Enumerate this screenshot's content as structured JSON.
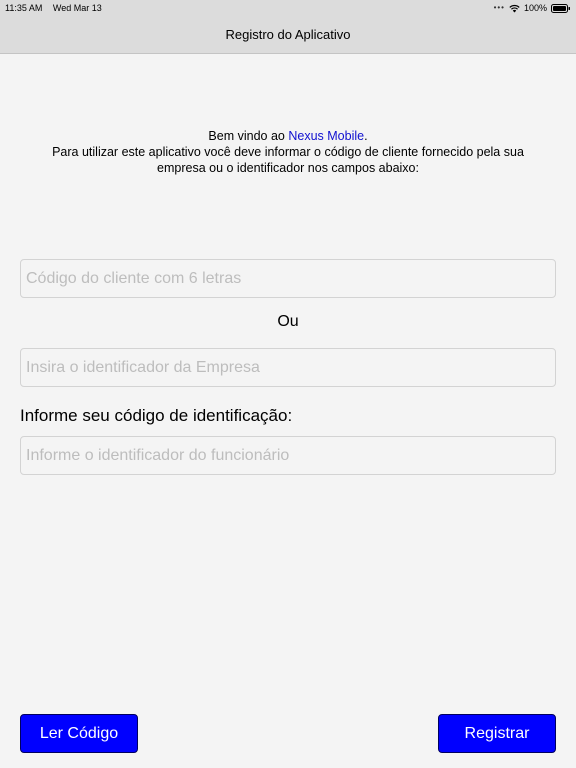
{
  "status_bar": {
    "time": "11:35 AM",
    "date": "Wed Mar 13",
    "battery": "100%",
    "icons": [
      "dots-icon",
      "wifi-icon",
      "battery-icon"
    ]
  },
  "nav": {
    "title": "Registro do Aplicativo"
  },
  "welcome": {
    "prefix": "Bem vindo ao ",
    "app_name": "Nexus Mobile",
    "suffix": ".",
    "line2": "Para utilizar este aplicativo você deve informar o código de cliente fornecido pela sua",
    "line3": "empresa ou o identificador nos campos abaixo:"
  },
  "form": {
    "client_code_placeholder": "Código do cliente com 6 letras",
    "client_code_value": "",
    "or_label": "Ou",
    "company_id_placeholder": "Insira o identificador da Empresa",
    "company_id_value": "",
    "employee_label": "Informe seu código de identificação:",
    "employee_id_placeholder": "Informe o identificador do funcionário",
    "employee_id_value": ""
  },
  "buttons": {
    "scan_label": "Ler Código",
    "register_label": "Registrar"
  },
  "colors": {
    "accent": "#0000ff",
    "link": "#1010d0",
    "background": "#f4f4f4",
    "bar": "#dcdcdc"
  }
}
